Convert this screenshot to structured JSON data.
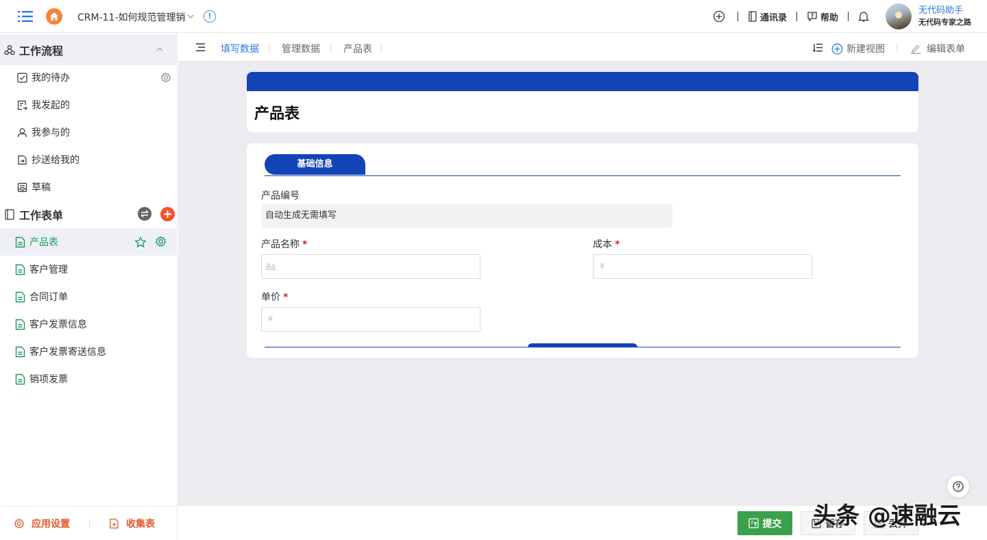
{
  "header": {
    "app_title": "CRM-11-如何规范管理销",
    "contacts_label": "通讯录",
    "help_label": "帮助",
    "user_name": "无代码助手",
    "user_subtitle": "无代码专家之路"
  },
  "sidebar": {
    "workflow_group": "工作流程",
    "workflow_items": [
      {
        "label": "我的待办",
        "icon": "checkbox-icon"
      },
      {
        "label": "我发起的",
        "icon": "send-doc-icon"
      },
      {
        "label": "我参与的",
        "icon": "user-icon"
      },
      {
        "label": "抄送给我的",
        "icon": "cc-doc-icon"
      },
      {
        "label": "草稿",
        "icon": "draft-icon"
      }
    ],
    "forms_group": "工作表单",
    "form_items": [
      {
        "label": "产品表",
        "selected": true
      },
      {
        "label": "客户管理"
      },
      {
        "label": "合同订单"
      },
      {
        "label": "客户发票信息"
      },
      {
        "label": "客户发票寄送信息"
      },
      {
        "label": "销项发票"
      }
    ],
    "footer": {
      "app_settings": "应用设置",
      "collect_form": "收集表"
    }
  },
  "tabs": {
    "items": [
      "填写数据",
      "管理数据",
      "产品表"
    ],
    "active_index": 0,
    "new_view": "新建视图",
    "edit_form": "编辑表单"
  },
  "form": {
    "title": "产品表",
    "section": "基础信息",
    "fields": {
      "product_no": {
        "label": "产品编号",
        "value": "自动生成无需填写"
      },
      "product_name": {
        "label": "产品名称",
        "required": true,
        "placeholder": "Aa"
      },
      "cost": {
        "label": "成本",
        "required": true,
        "placeholder": "¥"
      },
      "unit_price": {
        "label": "单价",
        "required": true,
        "placeholder": "¥"
      }
    }
  },
  "actions": {
    "submit": "提交",
    "save_draft": "暂存",
    "discard": "丢弃"
  },
  "watermark": "头条 @速融云",
  "colors": {
    "brand_blue": "#1443b7",
    "link_blue": "#2c7be5",
    "submit_green": "#3aa04a",
    "accent_orange": "#e05a2b",
    "selected_green": "#1a9a5a"
  }
}
